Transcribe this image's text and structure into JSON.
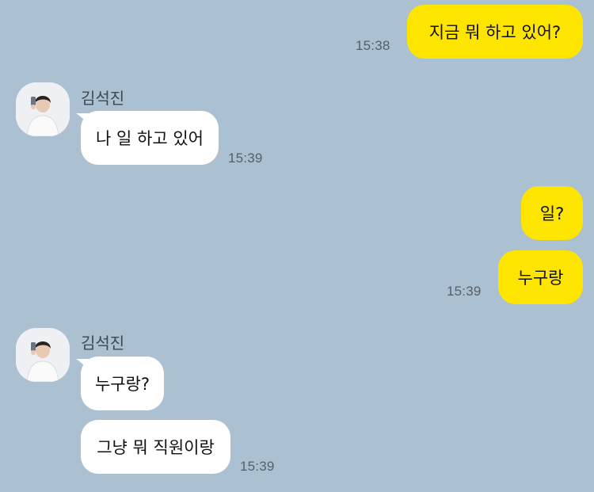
{
  "colors": {
    "background": "#abc1d1",
    "my_bubble": "#fee500",
    "other_bubble": "#ffffff",
    "timestamp": "#555f68"
  },
  "messages": {
    "m1": {
      "text": "지금 뭐 하고 있어?",
      "time": "15:38"
    },
    "g1": {
      "sender": "김석진",
      "m2": {
        "text": "나 일 하고 있어",
        "time": "15:39"
      }
    },
    "m3": {
      "text": "일?"
    },
    "m4": {
      "text": "누구랑",
      "time": "15:39"
    },
    "g2": {
      "sender": "김석진",
      "m5": {
        "text": "누구랑?"
      },
      "m6": {
        "text": "그냥 뭐 직원이랑",
        "time": "15:39"
      }
    }
  }
}
